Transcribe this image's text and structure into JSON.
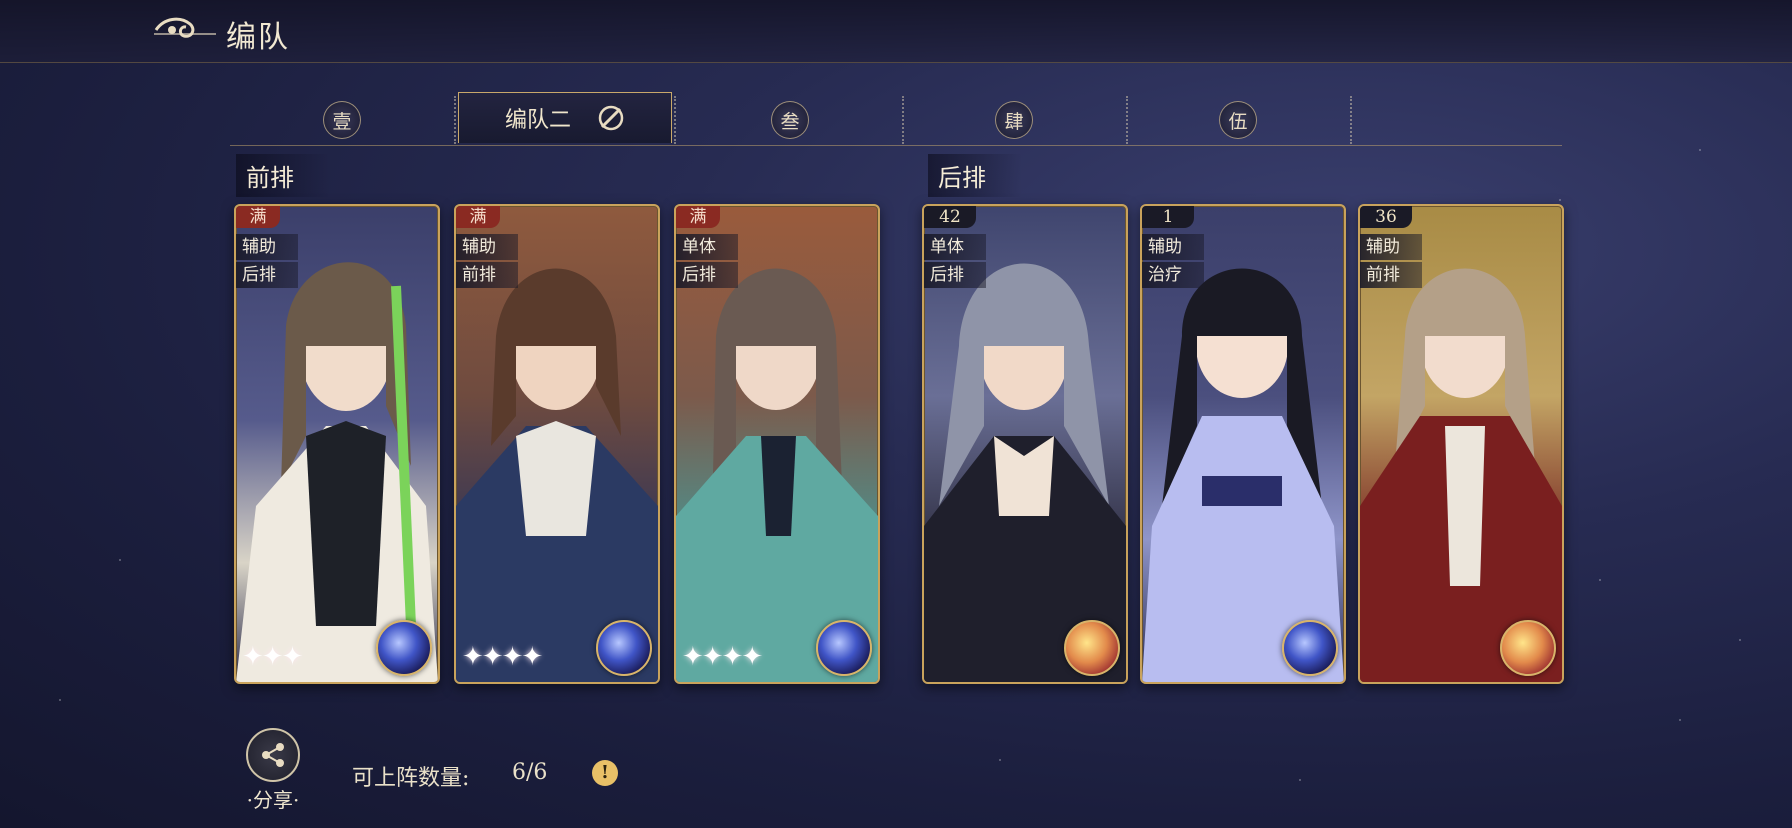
{
  "header": {
    "title": "编队"
  },
  "tabs": [
    {
      "label": "壹",
      "active": false
    },
    {
      "label": "编队二",
      "active": true
    },
    {
      "label": "叁",
      "active": false
    },
    {
      "label": "肆",
      "active": false
    },
    {
      "label": "伍",
      "active": false
    }
  ],
  "sections": {
    "front": "前排",
    "back": "后排"
  },
  "cards": [
    {
      "badge": "满",
      "badge_type": "full",
      "tags": [
        "辅助",
        "后排"
      ],
      "orb": "blue"
    },
    {
      "badge": "满",
      "badge_type": "full",
      "tags": [
        "辅助",
        "前排"
      ],
      "orb": "blue"
    },
    {
      "badge": "满",
      "badge_type": "full",
      "tags": [
        "单体",
        "后排"
      ],
      "orb": "blue"
    },
    {
      "badge": "42",
      "badge_type": "level",
      "tags": [
        "单体",
        "后排"
      ],
      "orb": "red"
    },
    {
      "badge": "1",
      "badge_type": "level",
      "tags": [
        "辅助",
        "治疗"
      ],
      "orb": "blue"
    },
    {
      "badge": "36",
      "badge_type": "level",
      "tags": [
        "辅助",
        "前排"
      ],
      "orb": "red"
    }
  ],
  "footer": {
    "share_label": "·分享·",
    "count_label": "可上阵数量:",
    "count_value": "6/6",
    "info_icon": "!"
  },
  "colors": {
    "accent_gold": "#c9a35c",
    "full_badge": "#8a2a22",
    "info": "#e8c067"
  }
}
